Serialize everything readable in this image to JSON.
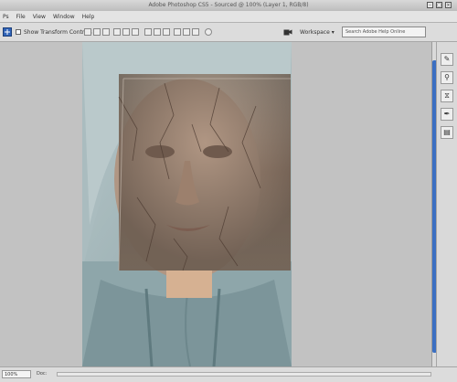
{
  "window": {
    "title": "Adobe Photoshop CS5 - Sourced @ 100% (Layer 1, RGB/8)"
  },
  "menu": {
    "items": [
      "Ps",
      "File",
      "View",
      "Window",
      "Help"
    ]
  },
  "options": {
    "show_transform_label": "Show Transform Controls",
    "workspace_label": "Workspace ▾",
    "search_placeholder": "Search Adobe Help Online"
  },
  "status": {
    "zoom": "100%",
    "doc_info": "Doc:"
  },
  "panel_icons": [
    "brush-icon",
    "stamp-icon",
    "history-icon",
    "pen-icon",
    "layers-icon"
  ],
  "colors": {
    "accent": "#3b6fc2",
    "workspace": "#c2c2c2"
  }
}
